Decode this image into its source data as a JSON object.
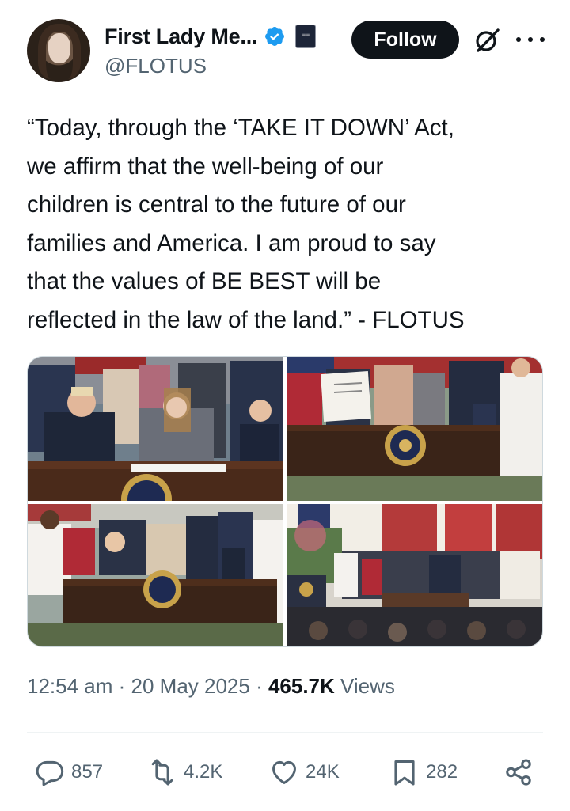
{
  "author": {
    "display_name": "First Lady Me...",
    "handle": "@FLOTUS",
    "verified": true,
    "affiliation_badge": "white-house-badge-icon",
    "avatar": "profile-photo"
  },
  "header": {
    "follow_label": "Follow",
    "grok_icon": "grok-icon",
    "more_icon": "more-options-icon"
  },
  "tweet": {
    "lines": [
      "“Today, through the ‘TAKE IT DOWN’ Act,",
      "we affirm that the well-being of our",
      "children is central to the future of our",
      "families and America. I am proud to say",
      "that the values of BE BEST will be",
      "reflected in the law of the land.” - FLOTUS"
    ]
  },
  "media": {
    "count": 4,
    "photos": [
      "bill-signing-photo-1",
      "bill-signing-photo-2",
      "bill-signing-photo-3",
      "bill-signing-photo-4"
    ]
  },
  "meta": {
    "time": "12:54 am",
    "separator": " · ",
    "date": "20 May 2025",
    "views_count": "465.7K",
    "views_label": " Views"
  },
  "actions": {
    "replies": "857",
    "reposts": "4.2K",
    "likes": "24K",
    "bookmarks": "282"
  },
  "colors": {
    "text": "#0f1419",
    "secondary": "#536471",
    "verified_blue": "#1d9bf0",
    "follow_bg": "#0f1419"
  }
}
